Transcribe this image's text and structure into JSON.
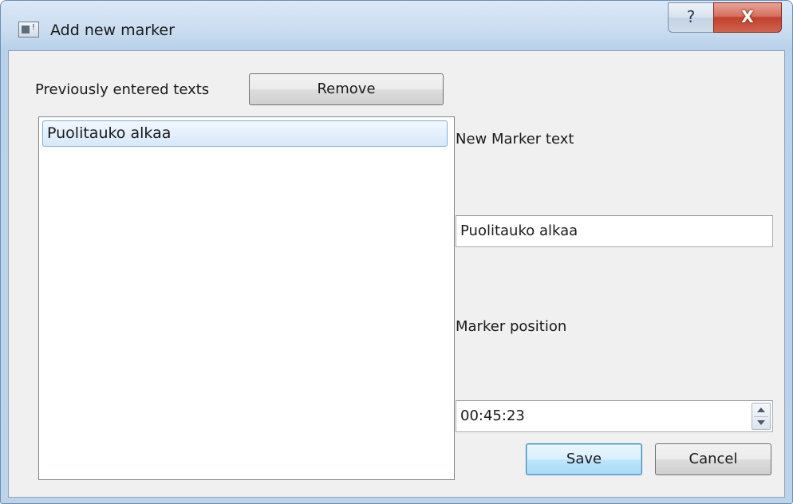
{
  "window": {
    "title": "Add new marker",
    "help_symbol": "?",
    "close_symbol": "X"
  },
  "left_panel": {
    "previous_label": "Previously entered texts",
    "remove_label": "Remove",
    "list_items": [
      "Puolitauko alkaa"
    ],
    "selected_index": 0
  },
  "right_panel": {
    "new_text_label": "New Marker text",
    "new_text_value": "Puolitauko alkaa",
    "position_label": "Marker position",
    "position_value": "00:45:23"
  },
  "buttons": {
    "save_label": "Save",
    "cancel_label": "Cancel"
  },
  "icons": {
    "app": "window-app-icon",
    "help": "help-icon",
    "close": "close-icon",
    "spin_up": "spin-up-icon",
    "spin_down": "spin-down-icon"
  },
  "colors": {
    "close_button": "#c2412c",
    "selection": "#d6e8fa",
    "dialog_bg": "#f0f0f0"
  }
}
